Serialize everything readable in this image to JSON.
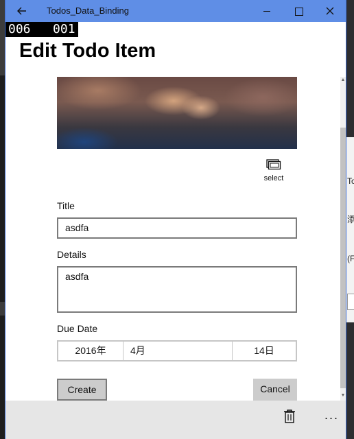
{
  "window": {
    "title": "Todos_Data_Binding",
    "back_icon": "arrow-left-icon",
    "controls": [
      "minimize-icon",
      "maximize-icon",
      "close-icon"
    ],
    "accent": "#5f8ee6"
  },
  "counter": {
    "left": "006",
    "right": "001"
  },
  "page": {
    "title": "Edit Todo Item"
  },
  "image": {
    "icon": "photo-placeholder"
  },
  "select_button": {
    "label": "select",
    "icon": "picture-select-icon"
  },
  "form": {
    "title_label": "Title",
    "title_value": "asdfa",
    "details_label": "Details",
    "details_value": "asdfa",
    "due_label": "Due Date",
    "due_year": "2016年",
    "due_month": "4月",
    "due_day": "14日"
  },
  "buttons": {
    "create": "Create",
    "cancel": "Cancel"
  },
  "appbar": {
    "delete_icon": "trash-icon",
    "more_label": "···"
  },
  "background_fragments": {
    "right_chars": [
      "To",
      "添",
      "(F"
    ]
  }
}
